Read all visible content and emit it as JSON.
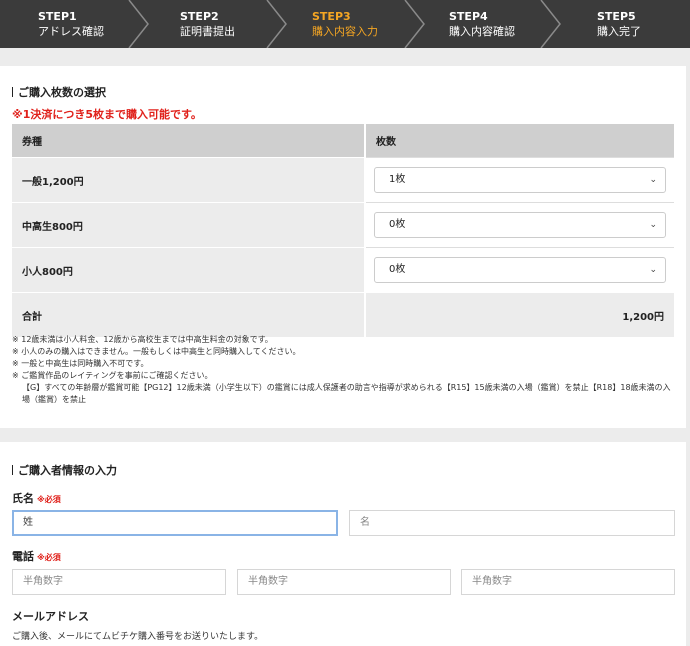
{
  "steps": [
    {
      "num": "STEP1",
      "label": "アドレス確認"
    },
    {
      "num": "STEP2",
      "label": "証明書提出"
    },
    {
      "num": "STEP3",
      "label": "購入内容入力"
    },
    {
      "num": "STEP4",
      "label": "購入内容確認"
    },
    {
      "num": "STEP5",
      "label": "購入完了"
    }
  ],
  "colors": {
    "active_step": "#f5a623",
    "required": "#e0201a",
    "focus_border": "#8ab4e6"
  },
  "tickets": {
    "title": "ご購入枚数の選択",
    "warning": "※1決済につき5枚まで購入可能です。",
    "headers": {
      "type": "券種",
      "count": "枚数"
    },
    "rows": [
      {
        "label": "一般1,200円",
        "selected": "1枚"
      },
      {
        "label": "中高生800円",
        "selected": "0枚"
      },
      {
        "label": "小人800円",
        "selected": "0枚"
      }
    ],
    "total_label": "合計",
    "total_value": "1,200円",
    "notes": [
      "※ 12歳未満は小人料金、12歳から高校生までは中高生料金の対象です。",
      "※ 小人のみの購入はできません。一般もしくは中高生と同時購入してください。",
      "※ 一般と中高生は同時購入不可です。",
      "※ ご鑑賞作品のレイティングを事前にご確認ください。",
      "【G】すべての年齢層が鑑賞可能【PG12】12歳未満（小学生以下）の鑑賞には成人保護者の助言や指導が求められる【R15】15歳未満の入場（鑑賞）を禁止【R18】18歳未満の入場（鑑賞）を禁止"
    ]
  },
  "buyer": {
    "title": "ご購入者情報の入力",
    "name_label": "氏名",
    "required": "※必須",
    "last_name_placeholder": "姓",
    "first_name_placeholder": "名",
    "phone_label": "電話",
    "phone_placeholder": "半角数字",
    "email_label": "メールアドレス",
    "email_desc": "ご購入後、メールにてムビチケ購入番号をお送りいたします。"
  }
}
